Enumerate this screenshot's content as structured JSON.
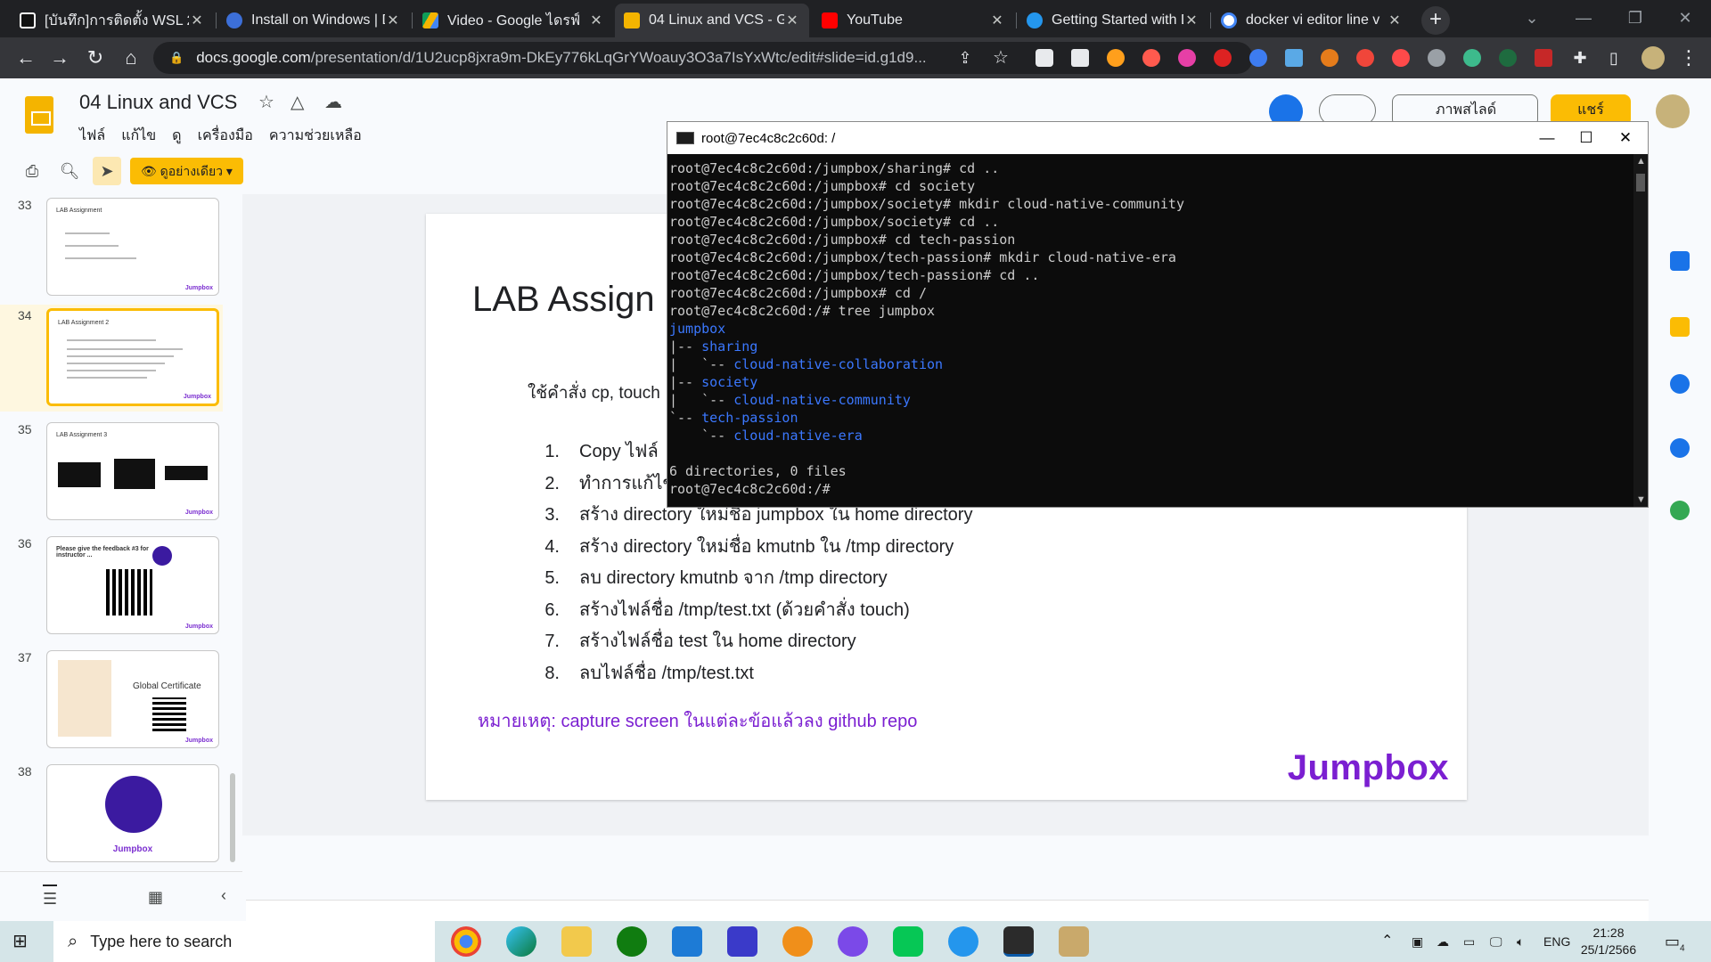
{
  "browser": {
    "tabs": [
      {
        "title": "[บันทึก]การติดตั้ง WSL 2",
        "active": false
      },
      {
        "title": "Install on Windows | D",
        "active": false
      },
      {
        "title": "Video - Google ไดรฟ์",
        "active": false
      },
      {
        "title": "04 Linux and VCS - G",
        "active": true
      },
      {
        "title": "YouTube",
        "active": false
      },
      {
        "title": "Getting Started with D",
        "active": false
      },
      {
        "title": "docker vi editor line v",
        "active": false
      }
    ],
    "url_host": "docs.google.com",
    "url_path": "/presentation/d/1U2ucp8jxra9m-DkEy776kLqGrYWoauy3O3a7IsYxWtc/edit#slide=id.g1d9..."
  },
  "slides_app": {
    "doc_title": "04 Linux and VCS",
    "menu": [
      "ไฟล์",
      "แก้ไข",
      "ดู",
      "เครื่องมือ",
      "ความช่วยเหลือ"
    ],
    "mode_button": "ดูอย่างเดียว",
    "present_button": "ภาพสไลด์",
    "share_button": "แชร์",
    "thumbnails": [
      {
        "number": "33",
        "title": "LAB Assignment",
        "brand": "Jumpbox"
      },
      {
        "number": "34",
        "title": "LAB Assignment 2",
        "brand": "Jumpbox"
      },
      {
        "number": "35",
        "title": "LAB Assignment 3",
        "brand": "Jumpbox"
      },
      {
        "number": "36",
        "title": "Please give the feedback #3 for instructor ...",
        "brand": "Jumpbox"
      },
      {
        "number": "37",
        "title": "Global Certificate",
        "brand": "Jumpbox"
      },
      {
        "number": "38",
        "title": "",
        "brand": "Jumpbox"
      }
    ],
    "slide": {
      "title": "LAB Assign",
      "subtitle": "ใช้คำสั่ง cp, touch",
      "items": [
        {
          "n": "1.",
          "text": "Copy ไฟล์"
        },
        {
          "n": "2.",
          "text": "ทำการแก้ไข"
        },
        {
          "n": "3.",
          "text": "สร้าง directory ใหม่ชื่อ jumpbox ใน home directory"
        },
        {
          "n": "4.",
          "text": "สร้าง directory ใหม่ชื่อ kmutnb ใน /tmp directory"
        },
        {
          "n": "5.",
          "text": "ลบ directory kmutnb จาก /tmp directory"
        },
        {
          "n": "6.",
          "text": "สร้างไฟล์ชื่อ /tmp/test.txt (ด้วยคำสั่ง touch)"
        },
        {
          "n": "7.",
          "text": "สร้างไฟล์ชื่อ test ใน home directory"
        },
        {
          "n": "8.",
          "text": "ลบไฟล์ชื่อ /tmp/test.txt"
        }
      ],
      "note": "หมายเหตุ: capture screen ในแต่ละข้อแล้วลง github repo",
      "brand": "Jumpbox"
    }
  },
  "terminal": {
    "title": "root@7ec4c8c2c60d: /",
    "lines": [
      {
        "text": "root@7ec4c8c2c60d:/jumpbox/sharing# cd ..",
        "color": "default"
      },
      {
        "text": "root@7ec4c8c2c60d:/jumpbox# cd society",
        "color": "default"
      },
      {
        "text": "root@7ec4c8c2c60d:/jumpbox/society# mkdir cloud-native-community",
        "color": "default"
      },
      {
        "text": "root@7ec4c8c2c60d:/jumpbox/society# cd ..",
        "color": "default"
      },
      {
        "text": "root@7ec4c8c2c60d:/jumpbox# cd tech-passion",
        "color": "default"
      },
      {
        "text": "root@7ec4c8c2c60d:/jumpbox/tech-passion# mkdir cloud-native-era",
        "color": "default"
      },
      {
        "text": "root@7ec4c8c2c60d:/jumpbox/tech-passion# cd ..",
        "color": "default"
      },
      {
        "text": "root@7ec4c8c2c60d:/jumpbox# cd /",
        "color": "default"
      },
      {
        "text": "root@7ec4c8c2c60d:/# tree jumpbox",
        "color": "default"
      },
      {
        "text": "jumpbox",
        "color": "blue"
      }
    ],
    "tree": [
      {
        "prefix": "|-- ",
        "name": "sharing"
      },
      {
        "prefix": "|   `-- ",
        "name": "cloud-native-collaboration"
      },
      {
        "prefix": "|-- ",
        "name": "society"
      },
      {
        "prefix": "|   `-- ",
        "name": "cloud-native-community"
      },
      {
        "prefix": "`-- ",
        "name": "tech-passion"
      },
      {
        "prefix": "    `-- ",
        "name": "cloud-native-era"
      }
    ],
    "summary": "6 directories, 0 files",
    "prompt": "root@7ec4c8c2c60d:/#"
  },
  "taskbar": {
    "search_placeholder": "Type here to search",
    "language": "ENG",
    "time": "21:28",
    "date": "25/1/2566",
    "notification_count": "4"
  },
  "colors": {
    "accent_yellow": "#fbbc04",
    "brand_purple": "#7b1fd1",
    "terminal_blue": "#3b78ff"
  }
}
